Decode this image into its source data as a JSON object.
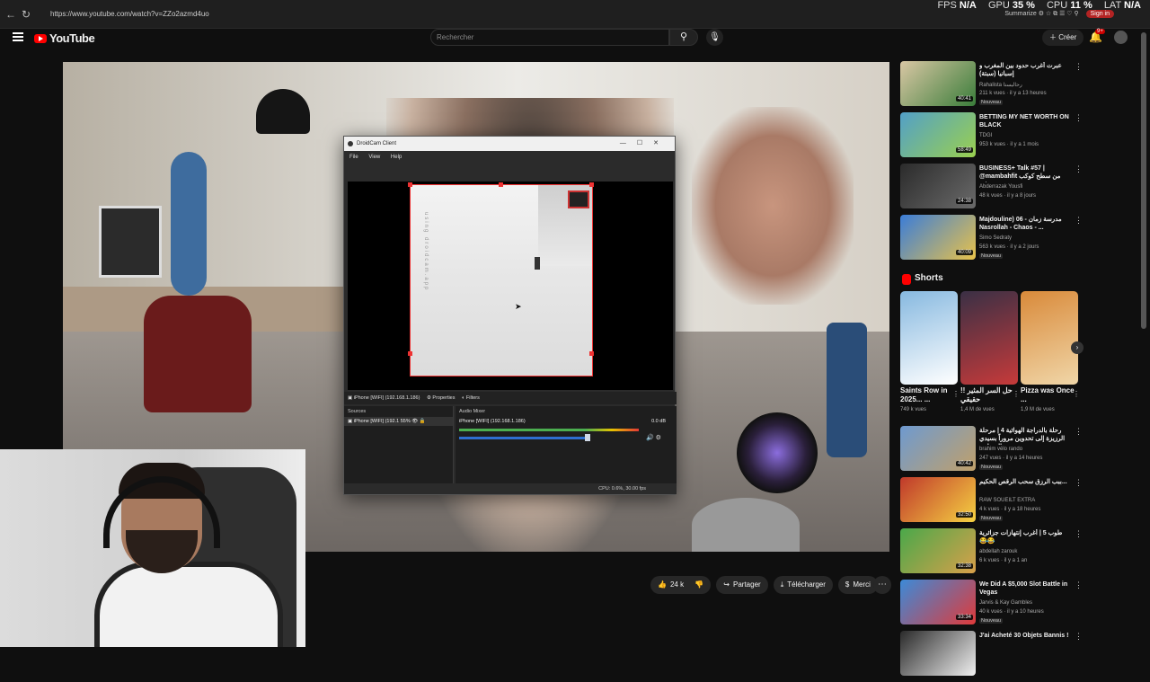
{
  "browser": {
    "url": "https://www.youtube.com/watch?v=ZZo2azmd4uo",
    "stats": [
      {
        "label": "FPS",
        "value": "N/A"
      },
      {
        "label": "GPU",
        "value": "35 %"
      },
      {
        "label": "CPU",
        "value": "11 %"
      },
      {
        "label": "LAT",
        "value": "N/A"
      }
    ],
    "summarize": "Summarize",
    "signin": "Sign in"
  },
  "youtube": {
    "logo": "YouTube",
    "search_placeholder": "Rechercher",
    "create_label": "Créer",
    "notif_count": "9+"
  },
  "droidcam": {
    "title": "DroidCam Client",
    "menu": [
      "File",
      "View",
      "Help"
    ],
    "watermark": "using droidcam.app",
    "source_bar": {
      "device": "iPhone [WIFI] (192.168.1.186)",
      "properties": "Properties",
      "filters": "Filters"
    },
    "sources_header": "Sources",
    "source_item": "iPhone [WIFI] (192.1",
    "source_pct": "55%",
    "mixer_header": "Audio Mixer",
    "mixer_item": "iPhone [WIFI] (192.168.1.186)",
    "mixer_db": "0.0 dB",
    "mixer_level": 0.7,
    "status": "CPU: 0.6%, 30.00 fps"
  },
  "actions": {
    "likes": "24 k",
    "share": "Partager",
    "download": "Télécharger",
    "thanks": "Merci"
  },
  "sidebar": {
    "videos_top": [
      {
        "title": "عبرت أغرب حدود بين المغرب و إسبانيا (سبتة)",
        "channel": "Rahalista رحاليستا",
        "meta": "211 k vues · il y a 13 heures",
        "duration": "40:41",
        "new": "Nouveau",
        "colors": [
          "#d9c7a4",
          "#3a7d3a"
        ]
      },
      {
        "title": "BETTING MY NET WORTH ON BLACK",
        "channel": "TDGI",
        "meta": "953 k vues · il y a 1 mois",
        "duration": "58:49",
        "new": "",
        "colors": [
          "#52a0c8",
          "#9ad04e"
        ]
      },
      {
        "title": "BUSINESS+ Talk #57 | @mambahfit من سطح كوكب في ...",
        "channel": "Abderrazak Yousfi",
        "meta": "48 k vues · il y a 8 jours",
        "duration": "24:38",
        "new": "",
        "colors": [
          "#2b2b2b",
          "#6a6a6a"
        ]
      },
      {
        "title": "Majdouline) 06 - مدرسة زمان Nasrollah - Chaos - ...",
        "channel": "Simo Sedraty",
        "meta": "563 k vues · il y a 2 jours",
        "duration": "40:09",
        "new": "Nouveau",
        "colors": [
          "#3b7dd8",
          "#e8c24a"
        ]
      }
    ],
    "shorts_heading": "Shorts",
    "shorts": [
      {
        "title": "Saints Row in 2025... ...",
        "views": "749 k vues",
        "colors": [
          "#87b9e0",
          "#ffffff"
        ]
      },
      {
        "title": "حل السر المثير !! حقيقي",
        "views": "1,4 M de vues",
        "colors": [
          "#3a3045",
          "#c63a3a"
        ]
      },
      {
        "title": "Pizza was Once ...",
        "views": "1,9 M de vues",
        "colors": [
          "#d98a3a",
          "#f0d6a8"
        ]
      }
    ],
    "videos_bottom": [
      {
        "title": "رحلة بالدراجة الهوائية 4 | مرحلة الرزيزة إلى تحدوين مروراً بسيدي رحال و ايت",
        "channel": "brahim vélo rando",
        "meta": "247 vues · il y a 14 heures",
        "duration": "40:42",
        "new": "Nouveau",
        "colors": [
          "#6e9ad0",
          "#c0a06a"
        ]
      },
      {
        "title": "ببب الرزق سحب الرقص الحكيم...",
        "channel": "RAW SOUEILT EXTRA",
        "meta": "4 k vues · il y a 18 heures",
        "duration": "32:50",
        "new": "Nouveau",
        "colors": [
          "#c0392b",
          "#f5d142"
        ]
      },
      {
        "title": "طوب 5 | أغرب إنتهازات جزائرية 😂😂",
        "channel": "abdellah zarouk",
        "meta": "6 k vues · il y a 1 an",
        "duration": "32:38",
        "new": "",
        "colors": [
          "#4aa84a",
          "#d8a04a"
        ]
      },
      {
        "title": "We Did A $5,000 Slot Battle in Vegas",
        "channel": "Jarvis & Kay Gambles",
        "meta": "40 k vues · il y a 10 heures",
        "duration": "33:34",
        "new": "Nouveau",
        "colors": [
          "#3c8ad8",
          "#e03a3a"
        ]
      },
      {
        "title": "J'ai Acheté 30 Objets Bannis !",
        "channel": "",
        "meta": "",
        "duration": "",
        "new": "",
        "colors": [
          "#2a2a2a",
          "#f0f0f0"
        ]
      }
    ]
  }
}
